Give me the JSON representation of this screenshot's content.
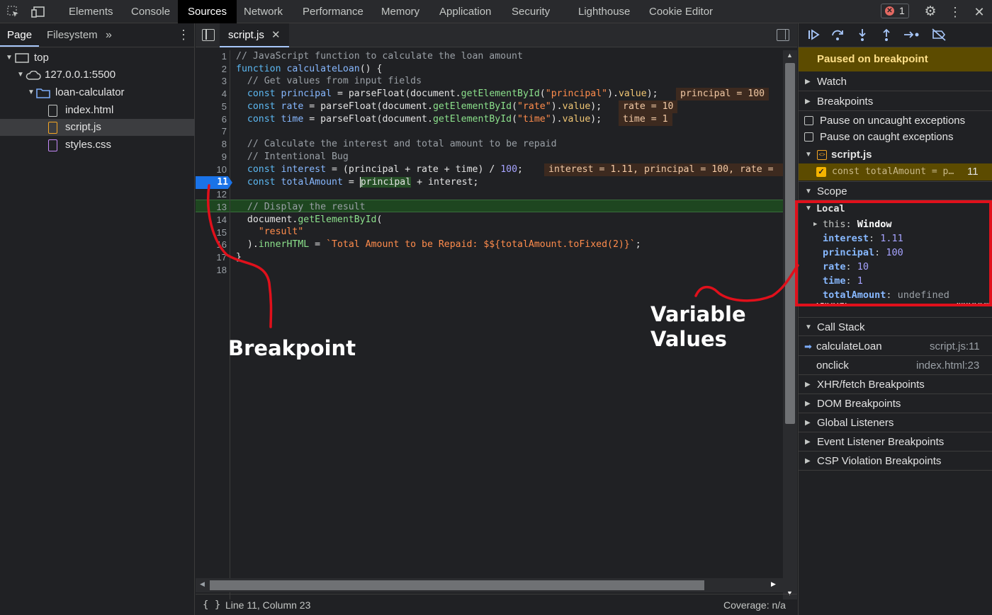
{
  "toolbar": {
    "tabs": [
      "Elements",
      "Console",
      "Sources",
      "Network",
      "Performance",
      "Memory",
      "Application",
      "Security",
      "Lighthouse",
      "Cookie Editor"
    ],
    "active_tab": "Sources",
    "error_count": "1"
  },
  "navigator": {
    "tabs": [
      "Page",
      "Filesystem"
    ],
    "tree": {
      "top": "top",
      "host": "127.0.0.1:5500",
      "folder": "loan-calculator",
      "files": [
        "index.html",
        "script.js",
        "styles.css"
      ]
    }
  },
  "editor": {
    "file_tab": "script.js",
    "line_numbers": [
      "1",
      "2",
      "3",
      "4",
      "5",
      "6",
      "7",
      "8",
      "9",
      "10",
      "11",
      "12",
      "13",
      "14",
      "15",
      "16",
      "17",
      "18"
    ],
    "paused_line": "11",
    "inline_values": {
      "l4": "principal = 100",
      "l5": "rate = 10",
      "l6": "time = 1",
      "l10": "interest = 1.11, principal = 100, rate = "
    },
    "status": {
      "position": "Line 11, Column 23",
      "coverage": "Coverage: n/a"
    }
  },
  "debugger": {
    "paused_label": "Paused on breakpoint",
    "sections": {
      "watch": "Watch",
      "breakpoints": "Breakpoints",
      "scope": "Scope",
      "call_stack": "Call Stack",
      "xhr": "XHR/fetch Breakpoints",
      "dom": "DOM Breakpoints",
      "global_listeners": "Global Listeners",
      "event_listener": "Event Listener Breakpoints",
      "csp": "CSP Violation Breakpoints"
    },
    "pause_uncaught": "Pause on uncaught exceptions",
    "pause_caught": "Pause on caught exceptions",
    "bp_file": "script.js",
    "bp_code": "const totalAmount = p…",
    "bp_line": "11",
    "scope": {
      "local_label": "Local",
      "this_key": "this",
      "this_val": "Window",
      "vars": [
        {
          "name": "interest",
          "value": "1.11"
        },
        {
          "name": "principal",
          "value": "100"
        },
        {
          "name": "rate",
          "value": "10"
        },
        {
          "name": "time",
          "value": "1"
        },
        {
          "name": "totalAmount",
          "value": "undefined"
        }
      ],
      "global_label": "Global",
      "global_val": "Window"
    },
    "call_stack": [
      {
        "fn": "calculateLoan",
        "loc": "script.js:11"
      },
      {
        "fn": "onclick",
        "loc": "index.html:23"
      }
    ]
  },
  "annotations": {
    "breakpoint": "Breakpoint",
    "variable_line1": "Variable",
    "variable_line2": "Values"
  },
  "colors": {
    "annotation_red": "#e0101b",
    "paused_bg": "#5c4b00",
    "breakpoint_blue": "#1a73e8",
    "paused_line_bg": "#1e4620"
  }
}
